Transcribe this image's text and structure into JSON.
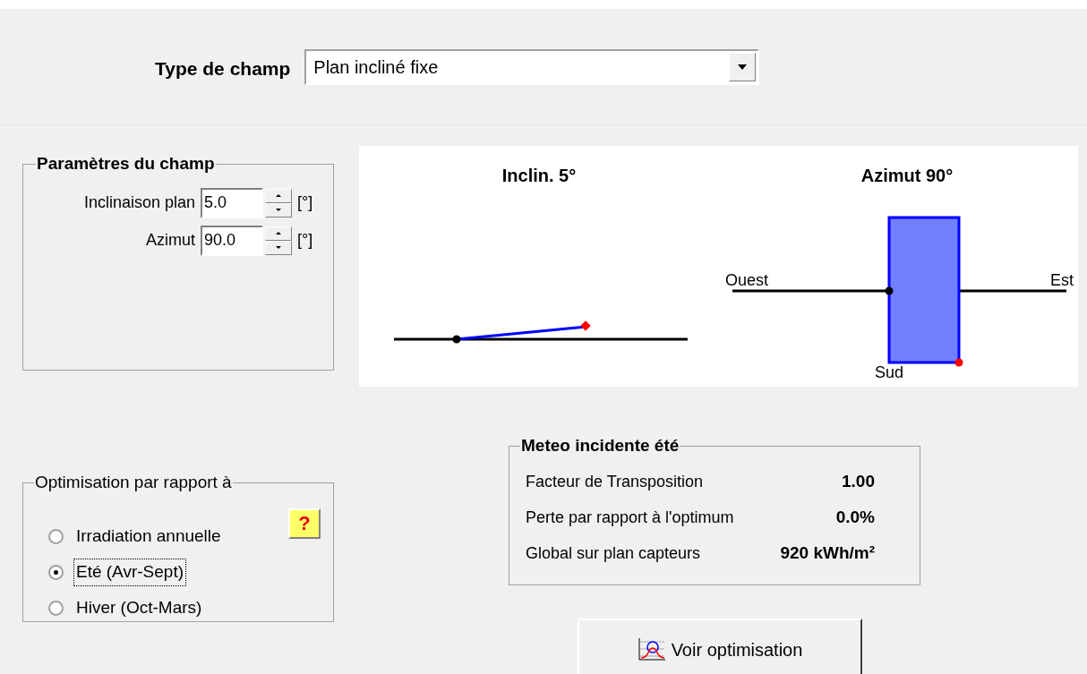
{
  "field_type": {
    "label": "Type de champ",
    "value": "Plan incliné fixe"
  },
  "field_parameters": {
    "title": "Paramètres du champ",
    "inputs": [
      {
        "label": "Inclinaison plan",
        "value": "5.0",
        "unit": "[°]"
      },
      {
        "label": "Azimut",
        "value": "90.0",
        "unit": "[°]"
      }
    ]
  },
  "diagram": {
    "tilt_title": "Inclin. 5°",
    "azimuth_title": "Azimut 90°",
    "west_label": "Ouest",
    "east_label": "Est",
    "south_label": "Sud"
  },
  "optimisation": {
    "title": "Optimisation par rapport à",
    "help_button": "?",
    "options": [
      {
        "label": "Irradiation annuelle",
        "selected": false
      },
      {
        "label": "Eté (Avr-Sept)",
        "selected": true
      },
      {
        "label": "Hiver (Oct-Mars)",
        "selected": false
      }
    ]
  },
  "meteo": {
    "title": "Meteo incidente été",
    "rows": [
      {
        "label": "Facteur de Transposition",
        "value": "1.00"
      },
      {
        "label": "Perte par rapport à l'optimum",
        "value": "0.0%"
      },
      {
        "label": "Global sur plan capteurs",
        "value": "920 kWh/m²"
      }
    ]
  },
  "buttons": [
    {
      "label": "Voir optimisation"
    }
  ]
}
